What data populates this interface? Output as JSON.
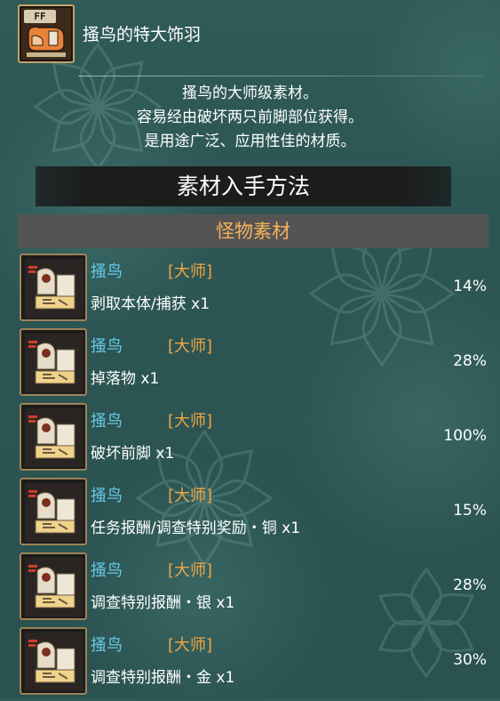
{
  "item": {
    "badge": "FF",
    "name": "搔鸟的特大饰羽",
    "icon": "material-claw-icon"
  },
  "description": [
    "搔鸟的大师级素材。",
    "容易经由破坏两只前脚部位获得。",
    "是用途广泛、应用性佳的材质。"
  ],
  "section": {
    "title": "素材入手方法",
    "category": "怪物素材"
  },
  "colors": {
    "monster_name": "#67c8e6",
    "rank": "#f0a545",
    "category_text": "#f3b25b",
    "category_bar": "#555454",
    "icon_border": "#9c8357"
  },
  "rows": [
    {
      "monster": "搔鸟",
      "rank": "[大师]",
      "method": "剥取本体/捕获 x1",
      "rate": "14%",
      "icon": "kulu-ya-ku-icon"
    },
    {
      "monster": "搔鸟",
      "rank": "[大师]",
      "method": "掉落物 x1",
      "rate": "28%",
      "icon": "kulu-ya-ku-icon"
    },
    {
      "monster": "搔鸟",
      "rank": "[大师]",
      "method": "破坏前脚 x1",
      "rate": "100%",
      "icon": "kulu-ya-ku-icon"
    },
    {
      "monster": "搔鸟",
      "rank": "[大师]",
      "method": "任务报酬/调查特别奖励・铜 x1",
      "rate": "15%",
      "icon": "kulu-ya-ku-icon"
    },
    {
      "monster": "搔鸟",
      "rank": "[大师]",
      "method": "调查特别报酬・银 x1",
      "rate": "28%",
      "icon": "kulu-ya-ku-icon"
    },
    {
      "monster": "搔鸟",
      "rank": "[大师]",
      "method": "调查特别报酬・金 x1",
      "rate": "30%",
      "icon": "kulu-ya-ku-icon"
    }
  ]
}
